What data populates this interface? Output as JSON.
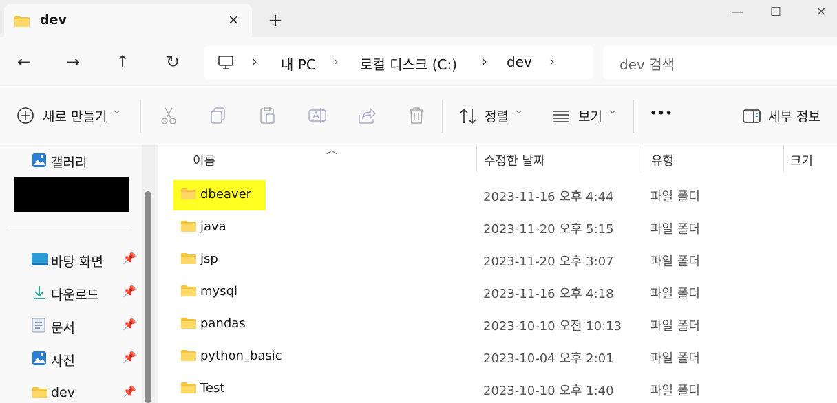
{
  "window": {
    "tab_title": "dev",
    "tab_close": "✕",
    "new_tab": "+",
    "minimize": "—",
    "maximize": "☐",
    "close": "✕"
  },
  "nav": {
    "back": "←",
    "forward": "→",
    "up": "↑",
    "refresh": "↻",
    "breadcrumb": [
      "내 PC",
      "로컬 디스크 (C:)",
      "dev"
    ],
    "chevron": "›",
    "search_placeholder": "dev 검색"
  },
  "command_bar": {
    "new_label": "새로 만들기",
    "sort_label": "정렬",
    "view_label": "보기",
    "more_label": "•••",
    "details_label": "세부 정보",
    "dropdown": "⌄"
  },
  "sidebar": {
    "gallery_label": "갤러리",
    "pinned": [
      {
        "label": "바탕 화면",
        "icon": "desktop-icon"
      },
      {
        "label": "다운로드",
        "icon": "download-icon"
      },
      {
        "label": "문서",
        "icon": "document-icon"
      },
      {
        "label": "사진",
        "icon": "pictures-icon"
      },
      {
        "label": "dev",
        "icon": "folder-icon"
      }
    ]
  },
  "columns": {
    "name": "이름",
    "modified": "수정한 날짜",
    "type": "유형",
    "size": "크기"
  },
  "files": [
    {
      "name": "dbeaver",
      "modified": "2023-11-16 오후 4:44",
      "type": "파일 폴더",
      "highlighted": true
    },
    {
      "name": "java",
      "modified": "2023-11-20 오후 5:15",
      "type": "파일 폴더"
    },
    {
      "name": "jsp",
      "modified": "2023-11-20 오후 3:07",
      "type": "파일 폴더"
    },
    {
      "name": "mysql",
      "modified": "2023-11-16 오후 4:18",
      "type": "파일 폴더"
    },
    {
      "name": "pandas",
      "modified": "2023-10-10 오전 10:13",
      "type": "파일 폴더"
    },
    {
      "name": "python_basic",
      "modified": "2023-10-04 오후 2:01",
      "type": "파일 폴더"
    },
    {
      "name": "Test",
      "modified": "2023-10-10 오후 1:40",
      "type": "파일 폴더"
    }
  ],
  "colors": {
    "highlight": "#ffff22",
    "folder": "#f5c542",
    "accent": "#0067c0"
  }
}
